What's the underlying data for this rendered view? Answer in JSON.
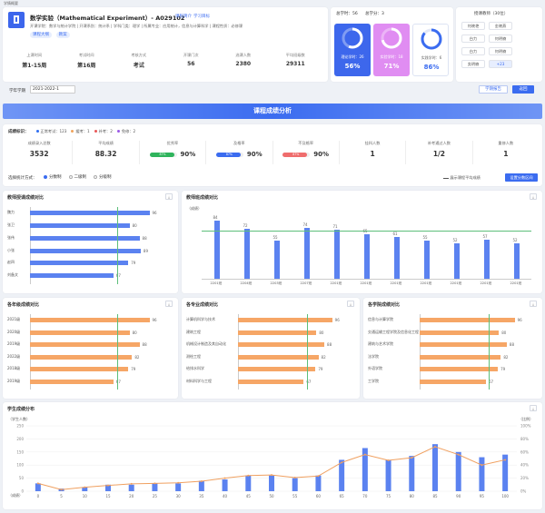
{
  "crumb": "学情概要",
  "course": {
    "title": "数学实验（Mathematical Experiment）- A029102",
    "links": [
      "课程简介",
      "学习目标"
    ],
    "desc": "开课学院：数学与统计学院 | 开课系别：统计系 | 学科门类：理学 | 所属专业：应用统计，信息与计算科学 | 课程性质：必修课",
    "tags": [
      "课程大纲",
      "教案"
    ],
    "stats": [
      {
        "label": "上课时间",
        "value": "第1-15周"
      },
      {
        "label": "考试时间",
        "value": "第16周"
      },
      {
        "label": "考核方式",
        "value": "考试"
      },
      {
        "label": "开课门次",
        "value": "56"
      },
      {
        "label": "选课人数",
        "value": "2380"
      },
      {
        "label": "平均班级数",
        "value": "29311"
      }
    ]
  },
  "hours": {
    "total_label": "总学时：56",
    "credit_label": "总学分：3",
    "cards": [
      {
        "label": "理论学时：26",
        "pct": "56%",
        "frac": 0.56,
        "color": "#4a70ee",
        "bg": "#3d67ec"
      },
      {
        "label": "实验学时：18",
        "pct": "71%",
        "frac": 0.71,
        "color": "#d87df0",
        "bg": "#e08df2"
      },
      {
        "label": "实践学时：6",
        "pct": "86%",
        "frac": 0.86,
        "color": "#3b6cf0",
        "bg": "#ffffff"
      }
    ]
  },
  "teachers": {
    "title": "授课教师（30位）",
    "names": [
      "何晓艳",
      "金晓燕",
      "白力",
      "何明楠",
      "白力",
      "何明楠",
      "卖明楠",
      "+23"
    ]
  },
  "term": {
    "label": "学年学期",
    "value": "2021-2022-1",
    "btn_report": "学期报告",
    "btn_back": "返回"
  },
  "banner": "课程成绩分析",
  "legend": {
    "label": "成绩标识：",
    "items": [
      {
        "text": "正常考试：123",
        "color": "#2f6ef2"
      },
      {
        "text": "缓考：1",
        "color": "#f0a35c"
      },
      {
        "text": "补考：2",
        "color": "#e95858"
      },
      {
        "text": "免修：2",
        "color": "#9b59e6"
      }
    ]
  },
  "kpis": [
    {
      "label": "成绩录入总数",
      "value": "3532"
    },
    {
      "label": "平均成绩",
      "value": "88.32"
    },
    {
      "label": "优秀率",
      "value": "90%",
      "badge": "87%",
      "color": "#2fb45c",
      "frac": 0.9
    },
    {
      "label": "及格率",
      "value": "90%",
      "badge": "87%",
      "color": "#3b6cf0",
      "frac": 0.9
    },
    {
      "label": "不及格率",
      "value": "90%",
      "badge": "87%",
      "color": "#ef6d6d",
      "frac": 0.9
    },
    {
      "label": "挂科人数",
      "value": "1"
    },
    {
      "label": "补考通过人数",
      "value": "1/2"
    },
    {
      "label": "重修人数",
      "value": "1"
    }
  ],
  "stat_mode": {
    "label": "选择统计方式：",
    "options": [
      "分数制",
      "二级制",
      "分级制"
    ],
    "avg_line": "展示课程平均成绩",
    "settings": "设置分数区间"
  },
  "chart_data": [
    {
      "id": "teacher",
      "type": "bar",
      "title": "教师授课成绩对比",
      "categories": [
        "魏力",
        "张卫",
        "张伟",
        "小张",
        "赵四",
        "刘备文"
      ],
      "values": [
        96,
        80,
        88,
        89,
        79,
        67
      ],
      "xlim": [
        0,
        100
      ],
      "avg": 70
    },
    {
      "id": "class",
      "type": "bar",
      "title": "教师班成绩对比",
      "ylabel": "（成绩）",
      "categories": [
        "2201班",
        "2204班",
        "2203班",
        "2207班",
        "2201班",
        "2201班",
        "2201班",
        "2201班",
        "2201班",
        "2201班",
        "2201班"
      ],
      "values": [
        84,
        72,
        55,
        74,
        71,
        65,
        61,
        55,
        52,
        57,
        52
      ],
      "ylim": [
        0,
        100
      ],
      "avg": 70
    },
    {
      "id": "year",
      "type": "bar",
      "title": "各年级成绩对比",
      "categories": [
        "2021级",
        "2020级",
        "2019级",
        "2022级",
        "2018级",
        "2019级"
      ],
      "values": [
        96,
        80,
        88,
        82,
        79,
        67
      ],
      "xlim": [
        0,
        100
      ],
      "avg": 70
    },
    {
      "id": "major",
      "type": "bar",
      "title": "各专业成绩对比",
      "categories": [
        "计算机科学与技术",
        "建筑工程",
        "机械设计制造及其自动化",
        "测绘工程",
        "给排水科学",
        "材料科学与工程"
      ],
      "values": [
        96,
        80,
        88,
        82,
        79,
        67
      ],
      "xlim": [
        0,
        100
      ],
      "avg": 70
    },
    {
      "id": "college",
      "type": "bar",
      "title": "各学院成绩对比",
      "categories": [
        "信息与计算学院",
        "交通运输工程学院及信息化工程",
        "建筑与艺术学院",
        "法学院",
        "外语学院",
        "工学院"
      ],
      "values": [
        96,
        80,
        88,
        82,
        79,
        67
      ],
      "xlim": [
        0,
        100
      ],
      "avg": 70
    },
    {
      "id": "dist",
      "type": "bar+line",
      "title": "学生成绩分布",
      "ylabel": "（学生人数）",
      "y2label": "（比例）",
      "xlabel": "（成绩）",
      "x": [
        0,
        5,
        10,
        15,
        20,
        25,
        30,
        35,
        40,
        45,
        50,
        55,
        60,
        65,
        70,
        75,
        80,
        85,
        90,
        95,
        100
      ],
      "values": [
        30,
        10,
        15,
        25,
        25,
        30,
        30,
        40,
        45,
        60,
        60,
        50,
        60,
        120,
        165,
        120,
        135,
        180,
        150,
        130,
        140
      ],
      "line": [
        30,
        6,
        15,
        22,
        28,
        30,
        32,
        38,
        50,
        60,
        62,
        52,
        58,
        110,
        140,
        118,
        128,
        170,
        140,
        100,
        120
      ],
      "ylim": [
        0,
        250
      ],
      "y2lim": [
        0,
        100
      ]
    }
  ]
}
